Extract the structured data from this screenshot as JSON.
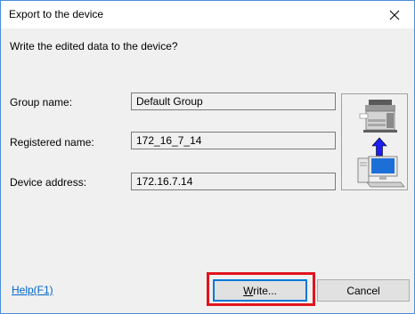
{
  "window": {
    "title": "Export to the device"
  },
  "dialog": {
    "prompt": "Write the edited data to the device?",
    "fields": [
      {
        "label": "Group name:",
        "value": "Default Group"
      },
      {
        "label": "Registered name:",
        "value": "172_16_7_14"
      },
      {
        "label": "Device address:",
        "value": "172.16.7.14"
      }
    ]
  },
  "footer": {
    "help_label": "Help(F1)",
    "write_mnemonic": "W",
    "write_rest": "rite...",
    "cancel_label": "Cancel"
  },
  "colors": {
    "accent": "#0078d7",
    "highlight": "#e0141e",
    "arrow": "#1d1df5",
    "link": "#0066cc"
  },
  "icons": {
    "close": "close-icon",
    "device_image": "copier-to-computer-transfer-icon"
  }
}
